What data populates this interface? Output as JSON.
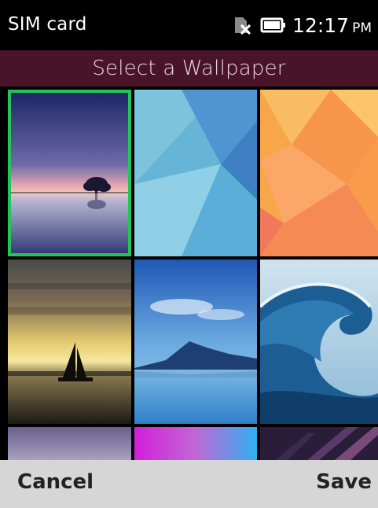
{
  "status_bar": {
    "carrier": "SIM card",
    "time": "12:17",
    "ampm": "PM",
    "icons": [
      "sim-missing-icon",
      "battery-icon"
    ]
  },
  "header": {
    "title": "Select a Wallpaper",
    "background": "#4a1428"
  },
  "wallpapers": {
    "selected_index": 0,
    "selection_color": "#25c45a",
    "items": [
      {
        "name": "tree-reflection-dusk"
      },
      {
        "name": "blue-geometric"
      },
      {
        "name": "orange-geometric"
      },
      {
        "name": "sailboat-sunset"
      },
      {
        "name": "mountain-lake"
      },
      {
        "name": "ocean-wave"
      },
      {
        "name": "purple-partial"
      },
      {
        "name": "magenta-gradient-partial"
      },
      {
        "name": "dark-stripes-partial"
      }
    ]
  },
  "softkeys": {
    "left": "Cancel",
    "right": "Save"
  }
}
